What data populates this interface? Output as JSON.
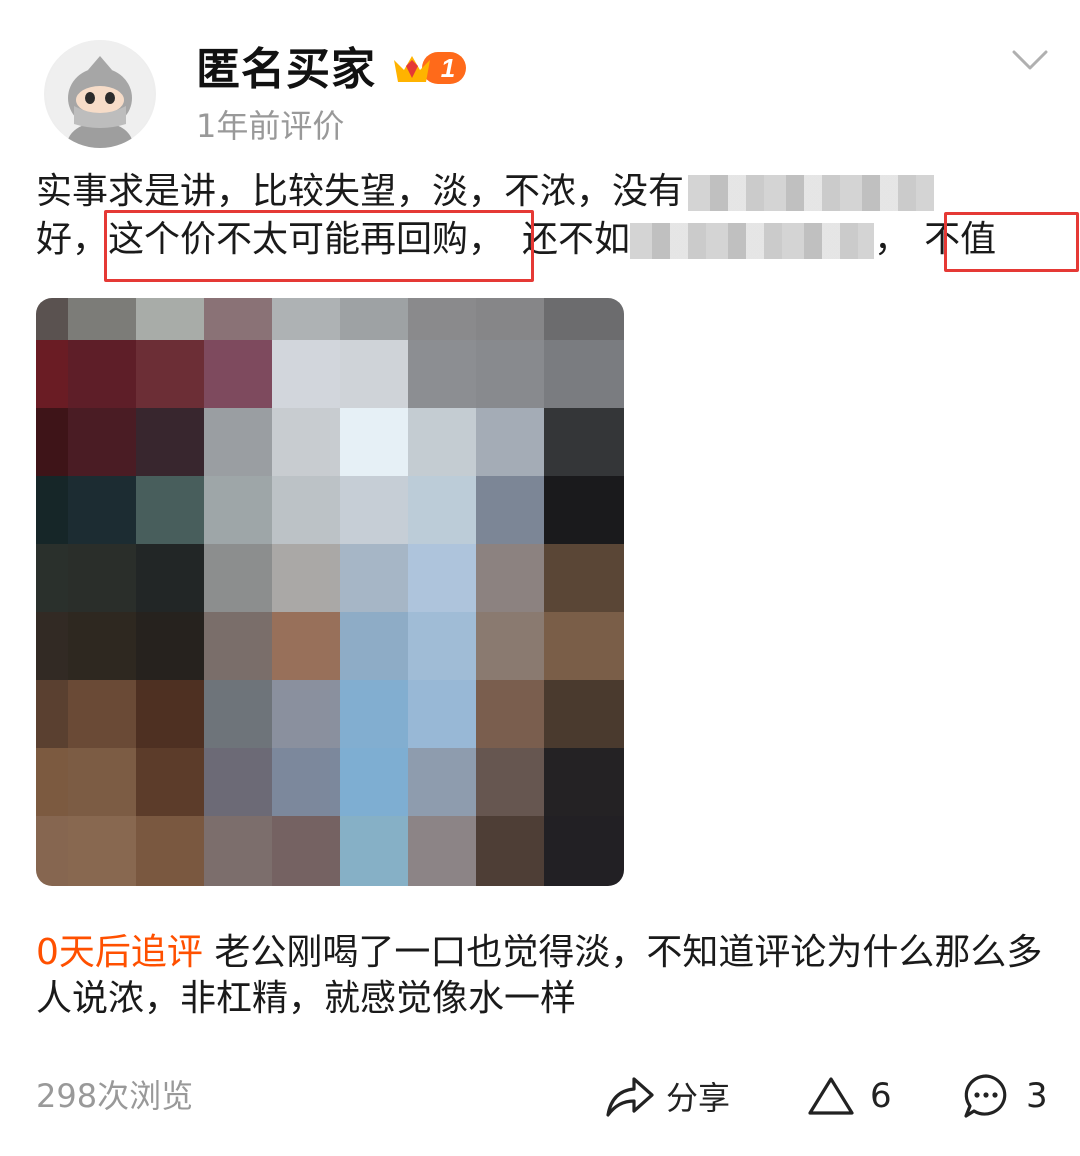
{
  "user": {
    "name": "匿名买家",
    "badge_level": "1",
    "time": "1年前评价"
  },
  "review": {
    "line1_a": "实事求是讲，比较失望，淡，不浓，没有",
    "line2_a": "好，",
    "line2_highlight": "这个价不太可能再回购，",
    "line2_b": "还不如",
    "line2_c": "，",
    "line2_highlight2": "不值"
  },
  "followup": {
    "tag": "0天后追评",
    "text": " 老公刚喝了一口也觉得淡，不知道评论为什么那么多人说浓，非杠精，就感觉像水一样"
  },
  "footer": {
    "views": "298次浏览",
    "share_label": "分享",
    "like_count": "6",
    "comment_count": "3"
  },
  "colors": {
    "accent_orange": "#ff5000",
    "highlight_red": "#e53935",
    "muted_gray": "#999999"
  },
  "icons": [
    "avatar-icon",
    "chevron-down-icon",
    "share-icon",
    "like-icon",
    "comment-icon",
    "vip-crown-icon"
  ]
}
